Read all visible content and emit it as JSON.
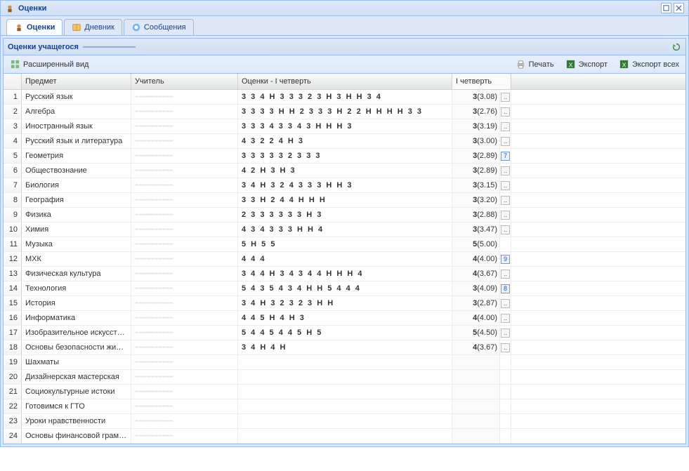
{
  "window": {
    "title": "Оценки"
  },
  "tabs": [
    {
      "label": "Оценки"
    },
    {
      "label": "Дневник"
    },
    {
      "label": "Сообщения"
    }
  ],
  "panel": {
    "title": "Оценки учащегося",
    "student": "———————"
  },
  "toolbar": {
    "expanded_view": "Расширенный вид",
    "print": "Печать",
    "export": "Экспорт",
    "export_all": "Экспорт всех"
  },
  "columns": {
    "subject": "Предмет",
    "teacher": "Учитель",
    "marks": "Оценки - I четверть",
    "quarter": "I четверть"
  },
  "rows": [
    {
      "n": "1",
      "subject": "Русский язык",
      "teacher": "—",
      "marks": "3 3 4 Н 3 3 3 2 3 Н 3 Н Н 3 4",
      "grade": "3",
      "avg": "(3.08)",
      "btn": ".."
    },
    {
      "n": "2",
      "subject": "Алгебра",
      "teacher": "—",
      "marks": "3 3 3 3 Н Н 2 3 3 3 Н 2 2 Н Н Н Н 3 3",
      "grade": "3",
      "avg": "(2.76)",
      "btn": ".."
    },
    {
      "n": "3",
      "subject": "Иностранный язык",
      "teacher": "—",
      "marks": "3 3 3 4 3 3 4 3 Н Н Н 3",
      "grade": "3",
      "avg": "(3.19)",
      "btn": ".."
    },
    {
      "n": "4",
      "subject": "Русский язык и литература",
      "teacher": "—",
      "marks": "4 3 2 2 4 Н 3",
      "grade": "3",
      "avg": "(3.00)",
      "btn": ".."
    },
    {
      "n": "5",
      "subject": "Геометрия",
      "teacher": "—",
      "marks": "3 3 3 3 3 2 3 3 3",
      "grade": "3",
      "avg": "(2.89)",
      "btn": "7",
      "blue": true
    },
    {
      "n": "6",
      "subject": "Обществознание",
      "teacher": "—",
      "marks": "4 2 Н 3 Н 3",
      "grade": "3",
      "avg": "(2.89)",
      "btn": ".."
    },
    {
      "n": "7",
      "subject": "Биология",
      "teacher": "—",
      "marks": "3 4 Н 3 2 4 3 3 3 Н Н 3",
      "grade": "3",
      "avg": "(3.15)",
      "btn": ".."
    },
    {
      "n": "8",
      "subject": "География",
      "teacher": "—",
      "marks": "3 3 Н 2 4 4 Н Н Н",
      "grade": "3",
      "avg": "(3.20)",
      "btn": ".."
    },
    {
      "n": "9",
      "subject": "Физика",
      "teacher": "—",
      "marks": "2 3 3 3 3 3 3 Н 3",
      "grade": "3",
      "avg": "(2.88)",
      "btn": ".."
    },
    {
      "n": "10",
      "subject": "Химия",
      "teacher": "—",
      "marks": "4 3 4 3 3 3 Н Н 4",
      "grade": "3",
      "avg": "(3.47)",
      "btn": ".."
    },
    {
      "n": "11",
      "subject": "Музыка",
      "teacher": "—",
      "marks": "5 Н 5 5",
      "grade": "5",
      "avg": "(5.00)",
      "btn": ""
    },
    {
      "n": "12",
      "subject": "МХК",
      "teacher": "—",
      "marks": "4 4 4",
      "grade": "4",
      "avg": "(4.00)",
      "btn": "9",
      "blue": true
    },
    {
      "n": "13",
      "subject": "Физическая культура",
      "teacher": "—",
      "marks": "3 4 4 Н 3 4 3 4 4 Н Н Н 4",
      "grade": "4",
      "avg": "(3.67)",
      "btn": ".."
    },
    {
      "n": "14",
      "subject": "Технология",
      "teacher": "—",
      "marks": "5 4 3 5 4 3 4 Н Н 5 4 4 4",
      "grade": "3",
      "avg": "(4.09)",
      "btn": "8",
      "blue": true
    },
    {
      "n": "15",
      "subject": "История",
      "teacher": "—",
      "marks": "3 4 Н 3 2 3 2 3 Н Н",
      "grade": "3",
      "avg": "(2.87)",
      "btn": ".."
    },
    {
      "n": "16",
      "subject": "Информатика",
      "teacher": "—",
      "marks": "4 4 5 Н 4 Н 3",
      "grade": "4",
      "avg": "(4.00)",
      "btn": ".."
    },
    {
      "n": "17",
      "subject": "Изобразительное искусст…",
      "teacher": "—",
      "marks": "5 4 4 5 4 4 5 Н 5",
      "grade": "5",
      "avg": "(4.50)",
      "btn": ".."
    },
    {
      "n": "18",
      "subject": "Основы безопасности жи…",
      "teacher": "—",
      "marks": "3 4 Н 4 Н",
      "grade": "4",
      "avg": "(3.67)",
      "btn": ".."
    },
    {
      "n": "19",
      "subject": "Шахматы",
      "teacher": "—",
      "marks": "",
      "grade": "",
      "avg": "",
      "btn": ""
    },
    {
      "n": "20",
      "subject": "Дизайнерская мастерская",
      "teacher": "—",
      "marks": "",
      "grade": "",
      "avg": "",
      "btn": ""
    },
    {
      "n": "21",
      "subject": "Социокультурные истоки",
      "teacher": "—",
      "marks": "",
      "grade": "",
      "avg": "",
      "btn": ""
    },
    {
      "n": "22",
      "subject": "Готовимся к ГТО",
      "teacher": "—",
      "marks": "",
      "grade": "",
      "avg": "",
      "btn": ""
    },
    {
      "n": "23",
      "subject": "Уроки нравственности",
      "teacher": "—",
      "marks": "",
      "grade": "",
      "avg": "",
      "btn": ""
    },
    {
      "n": "24",
      "subject": "Основы финансовой грам…",
      "teacher": "—",
      "marks": "",
      "grade": "",
      "avg": "",
      "btn": ""
    }
  ]
}
